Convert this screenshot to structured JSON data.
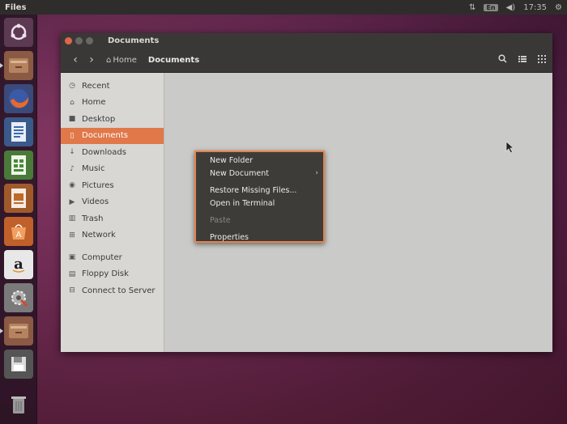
{
  "top_panel": {
    "app_name": "Files",
    "keyboard_layout": "En",
    "time": "17:35"
  },
  "launcher": {
    "items": [
      "ubuntu-dash",
      "files",
      "firefox",
      "libreoffice-writer",
      "libreoffice-calc",
      "libreoffice-impress",
      "ubuntu-software",
      "amazon",
      "system-settings",
      "files",
      "floppy",
      "trash"
    ]
  },
  "window": {
    "title": "Documents",
    "breadcrumbs": [
      "Home",
      "Documents"
    ],
    "sidebar": {
      "items": [
        {
          "label": "Recent",
          "icon": "clock-icon"
        },
        {
          "label": "Home",
          "icon": "home-icon"
        },
        {
          "label": "Desktop",
          "icon": "folder-icon"
        },
        {
          "label": "Documents",
          "icon": "document-icon",
          "active": true
        },
        {
          "label": "Downloads",
          "icon": "download-icon"
        },
        {
          "label": "Music",
          "icon": "music-icon"
        },
        {
          "label": "Pictures",
          "icon": "camera-icon"
        },
        {
          "label": "Videos",
          "icon": "video-icon"
        },
        {
          "label": "Trash",
          "icon": "trash-icon"
        },
        {
          "label": "Network",
          "icon": "network-icon"
        }
      ],
      "devices": [
        {
          "label": "Computer",
          "icon": "computer-icon"
        },
        {
          "label": "Floppy Disk",
          "icon": "floppy-icon"
        },
        {
          "label": "Connect to Server",
          "icon": "server-icon"
        }
      ]
    }
  },
  "context_menu": {
    "items": [
      {
        "label": "New Folder"
      },
      {
        "label": "New Document",
        "submenu": true
      },
      {
        "label": "Restore Missing Files..."
      },
      {
        "label": "Open in Terminal"
      },
      {
        "label": "Paste",
        "disabled": true
      },
      {
        "label": "Properties"
      }
    ]
  },
  "colors": {
    "accent": "#e0784a",
    "menu_border": "#e8834a"
  }
}
